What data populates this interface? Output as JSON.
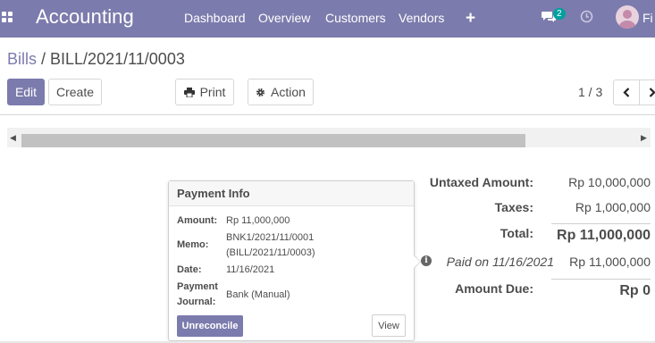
{
  "navbar": {
    "app_name": "Accounting",
    "menu": [
      "Dashboard",
      "Overview",
      "Customers",
      "Vendors"
    ],
    "messages_badge": "2",
    "user_name": "Fi",
    "icons": [
      "apps-grid-icon",
      "plus-icon",
      "chat-icon",
      "clock-icon"
    ]
  },
  "breadcrumb": {
    "parent": "Bills",
    "separator": " / ",
    "current": "BILL/2021/11/0003"
  },
  "actions": {
    "edit": "Edit",
    "create": "Create",
    "print": "Print",
    "action": "Action"
  },
  "pager": {
    "value": "1 / 3",
    "prev_icon": "chevron-left-icon",
    "next_icon": "chevron-right-icon"
  },
  "totals": {
    "untaxed_label": "Untaxed Amount:",
    "untaxed_value": "Rp 10,000,000",
    "taxes_label": "Taxes:",
    "taxes_value": "Rp 1,000,000",
    "total_label": "Total:",
    "total_value": "Rp 11,000,000",
    "paid_label": "Paid on 11/16/2021",
    "paid_value": "Rp 11,000,000",
    "due_label": "Amount Due:",
    "due_value": "Rp 0"
  },
  "payment_info": {
    "title": "Payment Info",
    "amount_label": "Amount:",
    "amount_value": "Rp 11,000,000",
    "memo_label": "Memo:",
    "memo_line1": "BNK1/2021/11/0001",
    "memo_line2": "(BILL/2021/11/0003)",
    "date_label": "Date:",
    "date_value": "11/16/2021",
    "journal_label_line1": "Payment",
    "journal_label_line2": "Journal:",
    "journal_value": "Bank (Manual)",
    "unreconcile": "Unreconcile",
    "view": "View"
  },
  "colors": {
    "brand": "#7c7bad",
    "badge": "#00a09d",
    "text": "#4c4c4c"
  }
}
